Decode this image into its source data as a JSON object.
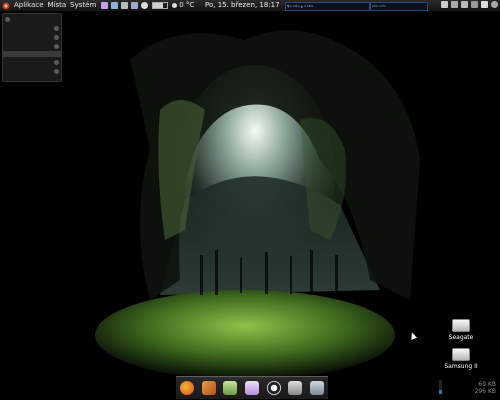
{
  "top_panel": {
    "menu": [
      "Aplikace",
      "Místa",
      "Systém"
    ],
    "clock": "Po, 15. březen, 18:17",
    "temperature": "0 °C",
    "battery_level": 0.7,
    "launcher_icons": [
      "browser-icon",
      "mail-icon",
      "terminal-icon",
      "network-icon",
      "settings-icon"
    ],
    "tray_icons": [
      "chat-icon",
      "volume-icon",
      "network-icon",
      "power-icon",
      "mail-icon",
      "user-icon"
    ],
    "graph1_text": "▼ 0 KB/s  ▲ 0 KB/s",
    "graph2_text": "CPU 12%"
  },
  "desktop_icons": [
    {
      "label": "Seagate",
      "icon": "drive-icon"
    },
    {
      "label": "Samsung II",
      "icon": "drive-icon"
    }
  ],
  "storage": {
    "line1": "69 KB",
    "line2": "296 KB",
    "usage_level": 0.3
  },
  "dock": [
    "firefox-icon",
    "tools-icon",
    "download-icon",
    "chat-icon",
    "settings-icon",
    "eject-icon",
    "monitor-icon"
  ],
  "colors": {
    "panel": "#1a1a1a",
    "accent": "#3b6db8"
  }
}
